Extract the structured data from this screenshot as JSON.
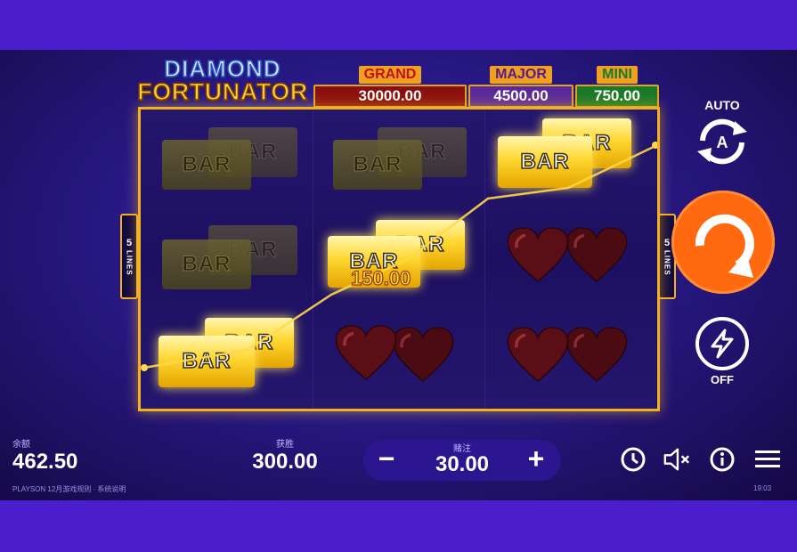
{
  "logo": {
    "line1": "DIAMOND",
    "line2": "FORTUNATOR"
  },
  "jackpots": {
    "grand": {
      "label": "GRAND",
      "value": "30000.00"
    },
    "major": {
      "label": "MAJOR",
      "value": "4500.00"
    },
    "mini": {
      "label": "MINI",
      "value": "750.00"
    }
  },
  "reels": {
    "symbol_bar": "BAR",
    "layout": [
      [
        "BAR",
        "BAR",
        "BAR"
      ],
      [
        "BAR",
        "BAR",
        "heart"
      ],
      [
        "BAR",
        "heart",
        "heart"
      ]
    ],
    "highlighted": [
      "BAR",
      "BAR",
      "BAR"
    ]
  },
  "lines_badge": {
    "count": "5",
    "label": "LINES"
  },
  "win_popup": "150.00",
  "controls": {
    "auto_label": "AUTO",
    "turbo_label": "OFF"
  },
  "hud": {
    "balance_caption": "余额",
    "balance": "462.50",
    "win_caption": "获胜",
    "win": "300.00",
    "bet_caption": "赌注",
    "bet": "30.00",
    "minus": "−",
    "plus": "+"
  },
  "footer": {
    "left": "PLAYSON  12月游戏规则 · 系统说明",
    "right": "19:03"
  },
  "colors": {
    "background": "#4a1ecb",
    "frame": "#f2b220",
    "spin": "#ff6a10"
  }
}
